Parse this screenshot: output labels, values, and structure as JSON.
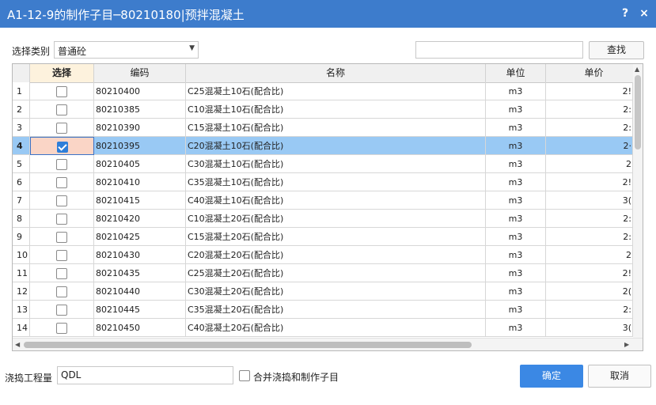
{
  "window": {
    "title": "A1-12-9的制作子目─80210180|预拌混凝土",
    "help_label": "?",
    "close_label": "×"
  },
  "filter": {
    "category_label": "选择类别",
    "category_value": "普通砼",
    "search_value": "",
    "search_button": "查找"
  },
  "table": {
    "columns": [
      "选择",
      "编码",
      "名称",
      "单位",
      "单价"
    ],
    "rows": [
      {
        "idx": "1",
        "checked": false,
        "code": "80210400",
        "name": "C25混凝土10石(配合比)",
        "unit": "m3",
        "price": "2!"
      },
      {
        "idx": "2",
        "checked": false,
        "code": "80210385",
        "name": "C10混凝土10石(配合比)",
        "unit": "m3",
        "price": "2:"
      },
      {
        "idx": "3",
        "checked": false,
        "code": "80210390",
        "name": "C15混凝土10石(配合比)",
        "unit": "m3",
        "price": "2:"
      },
      {
        "idx": "4",
        "checked": true,
        "code": "80210395",
        "name": "C20混凝土10石(配合比)",
        "unit": "m3",
        "price": "2·"
      },
      {
        "idx": "5",
        "checked": false,
        "code": "80210405",
        "name": "C30混凝土10石(配合比)",
        "unit": "m3",
        "price": "2"
      },
      {
        "idx": "6",
        "checked": false,
        "code": "80210410",
        "name": "C35混凝土10石(配合比)",
        "unit": "m3",
        "price": "2!"
      },
      {
        "idx": "7",
        "checked": false,
        "code": "80210415",
        "name": "C40混凝土10石(配合比)",
        "unit": "m3",
        "price": "3("
      },
      {
        "idx": "8",
        "checked": false,
        "code": "80210420",
        "name": "C10混凝土20石(配合比)",
        "unit": "m3",
        "price": "2:"
      },
      {
        "idx": "9",
        "checked": false,
        "code": "80210425",
        "name": "C15混凝土20石(配合比)",
        "unit": "m3",
        "price": "2:"
      },
      {
        "idx": "10",
        "checked": false,
        "code": "80210430",
        "name": "C20混凝土20石(配合比)",
        "unit": "m3",
        "price": "2"
      },
      {
        "idx": "11",
        "checked": false,
        "code": "80210435",
        "name": "C25混凝土20石(配合比)",
        "unit": "m3",
        "price": "2!"
      },
      {
        "idx": "12",
        "checked": false,
        "code": "80210440",
        "name": "C30混凝土20石(配合比)",
        "unit": "m3",
        "price": "2("
      },
      {
        "idx": "13",
        "checked": false,
        "code": "80210445",
        "name": "C35混凝土20石(配合比)",
        "unit": "m3",
        "price": "2:"
      },
      {
        "idx": "14",
        "checked": false,
        "code": "80210450",
        "name": "C40混凝土20石(配合比)",
        "unit": "m3",
        "price": "3("
      }
    ],
    "selected_row": "4"
  },
  "footer": {
    "qty_label": "浇捣工程量",
    "qty_value": "QDL",
    "merge_label": "合并浇捣和制作子目",
    "ok_button": "确定",
    "cancel_button": "取消"
  },
  "colors": {
    "titlebar": "#3d7ccc",
    "row_highlight": "#99c9f4",
    "primary_button": "#3b88e4"
  }
}
